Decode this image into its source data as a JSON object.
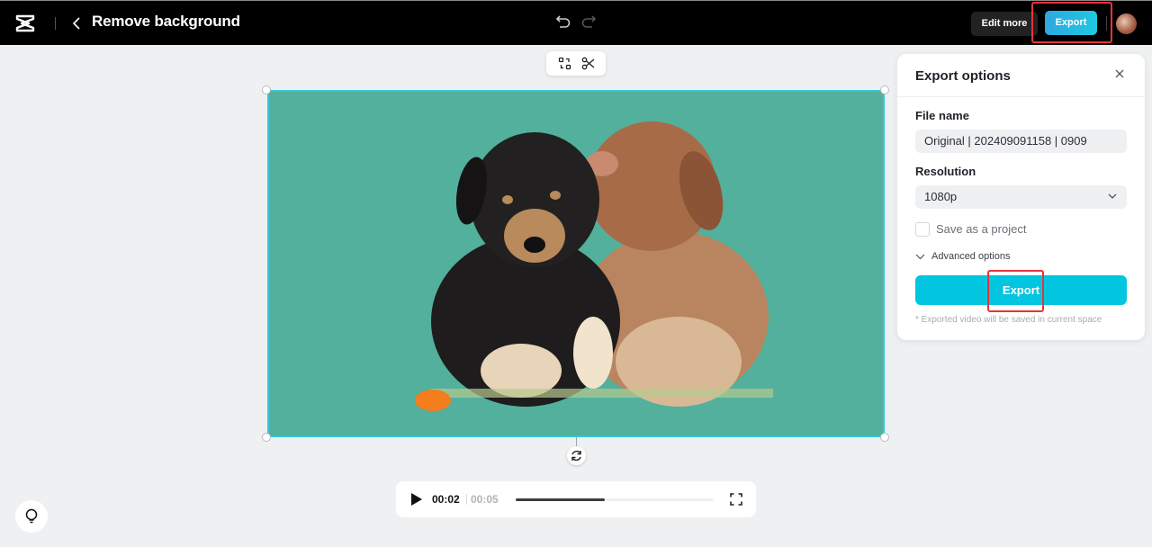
{
  "header": {
    "title": "Remove background",
    "logo_icon": "capcut-logo-icon",
    "back_icon": "chevron-left-icon",
    "undo_icon": "undo-icon",
    "redo_icon": "redo-icon",
    "edit_more_label": "Edit more",
    "export_label": "Export",
    "avatar": "user-avatar"
  },
  "canvas_toolbar": {
    "icons": [
      "replace-icon",
      "scissors-icon"
    ]
  },
  "canvas": {
    "background_color": "#52b09c",
    "content": "Two puppies with background removed on teal background"
  },
  "player": {
    "current_time": "00:02",
    "duration": "00:05",
    "progress": 0.45,
    "play_icon": "play-icon",
    "fullscreen_icon": "fullscreen-icon"
  },
  "export_panel": {
    "title": "Export options",
    "close_icon": "close-icon",
    "file_name_label": "File name",
    "file_name_value": "Original | 202409091158 | 0909",
    "resolution_label": "Resolution",
    "resolution_value": "1080p",
    "save_as_project_label": "Save as a project",
    "save_as_project_checked": false,
    "advanced_options_label": "Advanced options",
    "export_button_label": "Export",
    "note": "* Exported video will be saved in current space"
  },
  "colors": {
    "accent": "#02c6e0",
    "highlight": "#e5343a",
    "canvas_bg": "#52b09c"
  }
}
